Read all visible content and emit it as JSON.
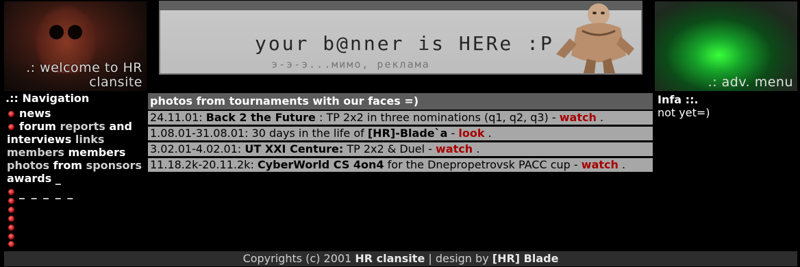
{
  "header": {
    "welcome_text": ".: welcome to HR clansite",
    "banner_main": "your b@nner is HERe :P",
    "banner_sub": "э-э-э...мимо, реклама",
    "adv_menu": ".: adv. menu"
  },
  "navigation": {
    "heading": ".:: Navigation",
    "items": [
      "news",
      "forum",
      "reports",
      "and",
      "interviews",
      "links",
      "members",
      "members",
      "photos",
      "from",
      "sponsors",
      "awards",
      "_"
    ],
    "dashes": "_ _ _ _ _"
  },
  "photos": {
    "heading": "photos from tournaments with our faces =)",
    "rows": [
      {
        "date": "24.11.01:",
        "title": "Back 2 the Future",
        "desc": ": TP 2x2 in three nominations (q1, q2, q3) -",
        "link": "watch",
        "end": "."
      },
      {
        "date": "1.08.01-31.08.01:",
        "desc_pre": "30 days in the life of",
        "title": "[HR]-Blade`a",
        "desc": "-",
        "link": "look",
        "end": "."
      },
      {
        "date": "3.02.01-4.02.01:",
        "title": "UT XXI Centure:",
        "desc": "TP 2x2 & Duel -",
        "link": "watch",
        "end": "."
      },
      {
        "date": "11.18.2k-20.11.2k:",
        "title": "CyberWorld CS 4on4",
        "desc": "for the Dnepropetrovsk PACC cup -",
        "link": "watch",
        "end": "."
      }
    ]
  },
  "info": {
    "title": "Infa ::.",
    "text": "not yet=)"
  },
  "footer": {
    "prefix": "Copyrights (c) 2001",
    "site": "HR clansite",
    "mid": "| design by",
    "designer": "[HR] Blade"
  },
  "colors": {
    "link_red": "#a80000",
    "row_bg": "#a7a7a7",
    "head_bg": "#5c5c5c",
    "footer_bg": "#2d2d2d"
  }
}
